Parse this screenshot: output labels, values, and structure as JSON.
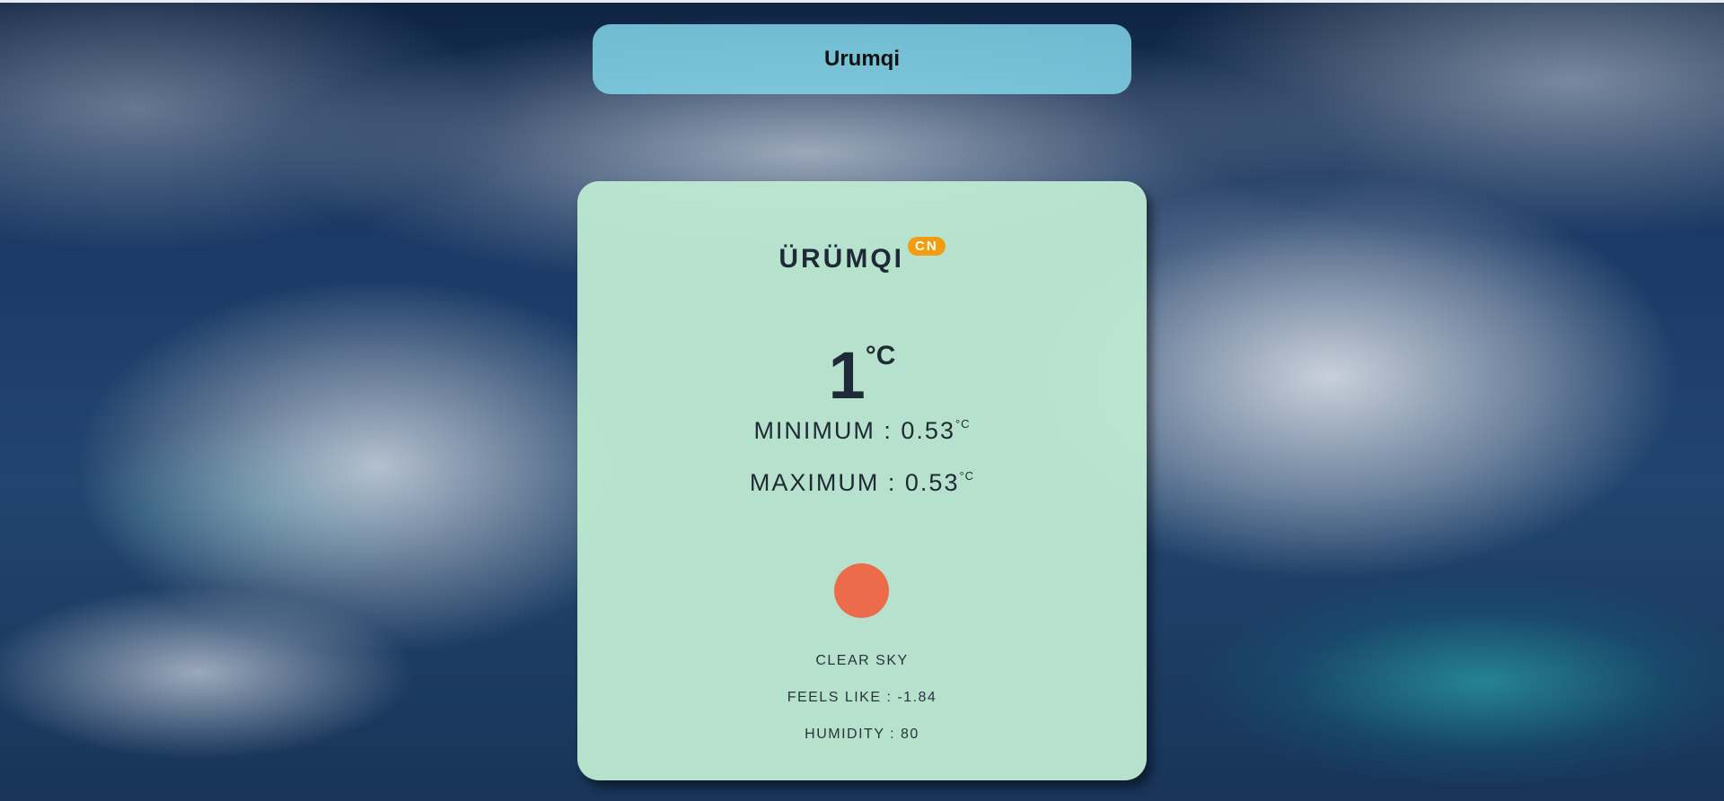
{
  "header": {
    "title": "Urumqi"
  },
  "card": {
    "city": "ÜRÜMQI",
    "country": "CN",
    "temperature": "1",
    "unit": "°C",
    "minimum_label": "MINIMUM : 0.53",
    "maximum_label": "MAXIMUM : 0.53",
    "weather_icon": "sun-icon",
    "description": "CLEAR SKY",
    "feels_like": "FEELS LIKE : -1.84",
    "humidity": "HUMIDITY : 80"
  },
  "colors": {
    "header_bg": "#80d4e8",
    "card_bg": "#bce8d0",
    "badge": "#f39c12",
    "sun": "#ec6b4b"
  }
}
